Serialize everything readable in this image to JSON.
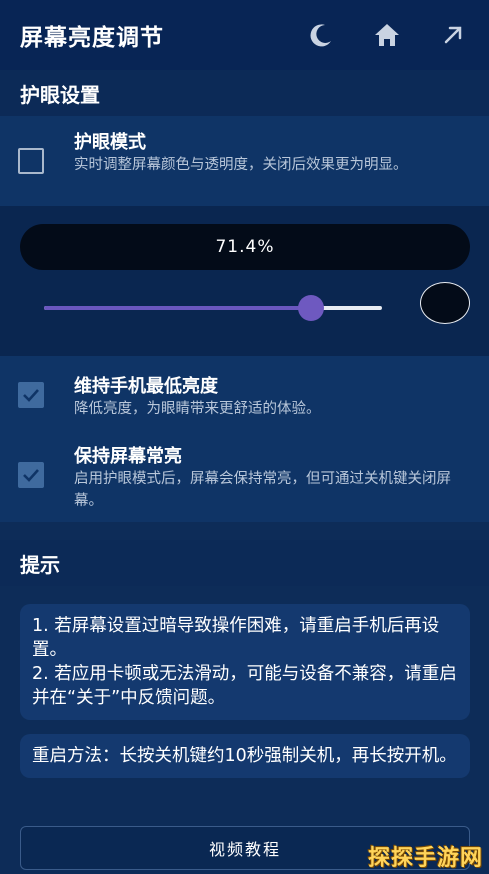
{
  "appbar": {
    "title": "屏幕亮度调节",
    "icons": [
      "moon-icon",
      "home-icon",
      "arrow-up-right-icon"
    ]
  },
  "eye_section": {
    "header": "护眼设置",
    "eye_mode": {
      "title": "护眼模式",
      "desc": "实时调整屏幕颜色与透明度，关闭后效果更为明显。",
      "checked": false
    }
  },
  "brightness": {
    "percent_label": "71.4%",
    "slider_fraction": 0.79,
    "swatch_color": "#030b18"
  },
  "options": [
    {
      "title": "维持手机最低亮度",
      "desc": "降低亮度，为眼睛带来更舒适的体验。",
      "checked": true
    },
    {
      "title": "保持屏幕常亮",
      "desc": "启用护眼模式后，屏幕会保持常亮，但可通过关机键关闭屏幕。",
      "checked": true
    }
  ],
  "tips": {
    "header": "提示",
    "card1_line1": "1. 若屏幕设置过暗导致操作困难，请重启手机后再设置。",
    "card1_line2": "2. 若应用卡顿或无法滑动，可能与设备不兼容，请重启并在“关于”中反馈问题。",
    "card2": "重启方法：长按关机键约10秒强制关机，再长按开机。"
  },
  "video_button": "视频教程",
  "watermark": "探探手游网",
  "colors": {
    "accent": "#6a57bf",
    "appbar_bg": "#082555",
    "panel_bg": "#0f3466",
    "card_bg": "#14396f"
  }
}
